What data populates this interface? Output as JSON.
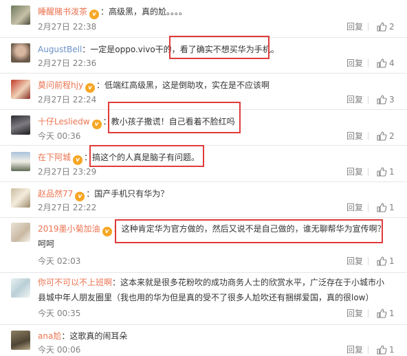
{
  "reply_label": "回复",
  "comments": [
    {
      "user": "睡醒赌书泼茶",
      "text": "：高级黑，真的尬。。。。",
      "time": "2月27日 22:38",
      "likes": "2",
      "avatar": "avatar-image"
    },
    {
      "user": "AugustBell",
      "text_a": "：一定是oppo.vivo干的，",
      "text_b": "看了确实不想买华为手机。",
      "time": "2月27日 22:36",
      "likes": "4",
      "avatar": "avatar-image"
    },
    {
      "user": "莫问前程hjy",
      "text": "：低端红高级黑，这是倒助攻，实在是不应该啊",
      "time": "2月27日 22:24",
      "likes": "3",
      "avatar": "avatar-image"
    },
    {
      "user": "十仔Lesliedw",
      "text_a": "：",
      "text_b": "教小孩子撒谎！自己看着不脸红吗",
      "time": "今天 00:36",
      "likes": "2",
      "avatar": "avatar-image"
    },
    {
      "user": "在下阿城",
      "text_a": "：",
      "text_b": "搞这个的人真是脑子有问题。",
      "time": "2月27日 23:29",
      "likes": "1",
      "avatar": "avatar-image"
    },
    {
      "user": "赵品然77",
      "text": "：国产手机只有华为？",
      "time": "2月27日 22:22",
      "likes": "1",
      "avatar": "avatar-image"
    },
    {
      "user": "2019墨小菊加油",
      "text_a": "：",
      "text_b": "这种肯定华为官方做的，然后又说不是自己做的，谁无聊帮华为宣传啊？",
      "text_c": "呵呵",
      "time": "今天 02:03",
      "likes": "1",
      "avatar": "avatar-image"
    },
    {
      "user": "你可不可以不上班啊",
      "text": "：这本来就是很多花粉吹的成功商务人士的欣赏水平，广泛存在于小城市小县城中年人朋友圈里（我也用的华为但是真的受不了很多人尬吹还有捆绑爱国，真的很low）",
      "time": "今天 00:35",
      "likes": "1",
      "avatar": "avatar-image"
    },
    {
      "user": "ana尬",
      "text": "：这歌真的闹耳朵",
      "time": "今天 00:06",
      "likes": "1",
      "avatar": "avatar-image"
    }
  ],
  "icons": {
    "badge": "verified-badge-icon",
    "like": "thumbs-up-icon"
  },
  "colors": {
    "username": "#eb7350",
    "highlight": "#e03a3a",
    "meta": "#808080"
  }
}
